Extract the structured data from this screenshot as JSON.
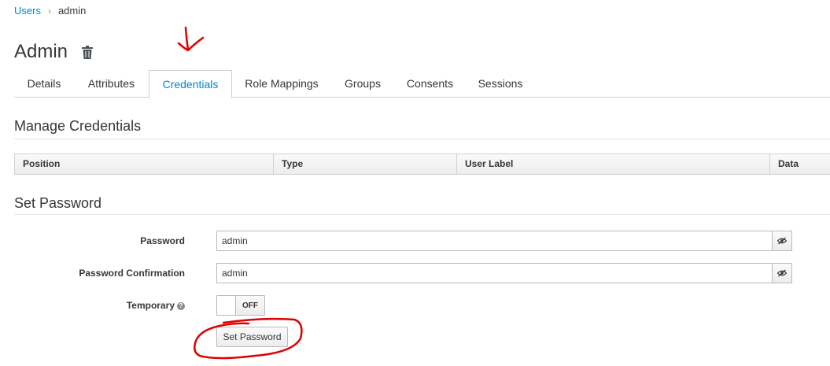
{
  "breadcrumb": {
    "parent": "Users",
    "separator": "›",
    "current": "admin"
  },
  "title": "Admin",
  "tabs": [
    "Details",
    "Attributes",
    "Credentials",
    "Role Mappings",
    "Groups",
    "Consents",
    "Sessions"
  ],
  "active_tab": "Credentials",
  "manage_credentials": {
    "title": "Manage Credentials",
    "columns": [
      "Position",
      "Type",
      "User Label",
      "Data"
    ]
  },
  "set_password": {
    "title": "Set Password",
    "password_label": "Password",
    "password_value": "admin",
    "confirm_label": "Password Confirmation",
    "confirm_value": "admin",
    "temporary_label": "Temporary",
    "temporary_state": "OFF",
    "submit_label": "Set Password"
  },
  "icons": {
    "trash": "trash-icon",
    "eye_toggle": "eye-slash-icon",
    "help": "question-circle-icon"
  },
  "colors": {
    "link": "#0088ce",
    "annotation": "#e00000"
  }
}
